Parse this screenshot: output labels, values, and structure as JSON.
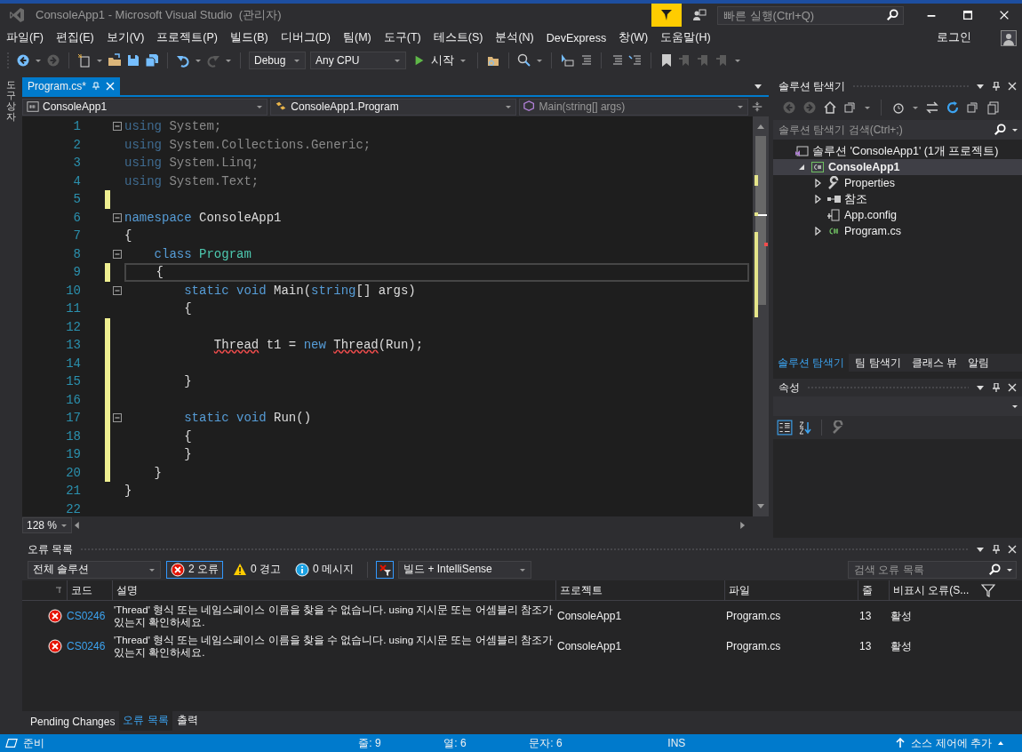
{
  "window": {
    "title": "ConsoleApp1 - Microsoft Visual Studio  (관리자)",
    "quick_launch_placeholder": "빠른 실행(Ctrl+Q)"
  },
  "menu": [
    {
      "label": "파일(F)"
    },
    {
      "label": "편집(E)"
    },
    {
      "label": "보기(V)"
    },
    {
      "label": "프로젝트(P)"
    },
    {
      "label": "빌드(B)"
    },
    {
      "label": "디버그(D)"
    },
    {
      "label": "팀(M)"
    },
    {
      "label": "도구(T)"
    },
    {
      "label": "테스트(S)"
    },
    {
      "label": "분석(N)"
    },
    {
      "label": "DevExpress"
    },
    {
      "label": "창(W)"
    },
    {
      "label": "도움말(H)"
    }
  ],
  "account": {
    "label": "로그인"
  },
  "toolbar": {
    "configuration": "Debug",
    "platform": "Any CPU",
    "start": "시작"
  },
  "toolbox": {
    "label": "도구 상자"
  },
  "editor": {
    "tab": {
      "label": "Program.cs*",
      "selected": true
    },
    "nav": [
      "ConsoleApp1",
      "ConsoleApp1.Program",
      "Main(string[] args)"
    ],
    "zoom": "128 %",
    "lines": [
      {
        "number": "1",
        "fold": true,
        "modified": false,
        "current": false,
        "tokens": [
          {
            "text": "using",
            "kind": "unused-keyword"
          },
          {
            "text": " System;",
            "kind": "unused"
          }
        ]
      },
      {
        "number": "2",
        "fold": false,
        "modified": false,
        "current": false,
        "tokens": [
          {
            "text": "using",
            "kind": "unused-keyword"
          },
          {
            "text": " System.Collections.Generic;",
            "kind": "unused"
          }
        ]
      },
      {
        "number": "3",
        "fold": false,
        "modified": false,
        "current": false,
        "tokens": [
          {
            "text": "using",
            "kind": "unused-keyword"
          },
          {
            "text": " System.Linq;",
            "kind": "unused"
          }
        ]
      },
      {
        "number": "4",
        "fold": false,
        "modified": false,
        "current": false,
        "tokens": [
          {
            "text": "using",
            "kind": "unused-keyword"
          },
          {
            "text": " System.Text;",
            "kind": "unused"
          }
        ]
      },
      {
        "number": "5",
        "fold": false,
        "modified": true,
        "current": false
      },
      {
        "number": "6",
        "fold": true,
        "modified": false,
        "current": false,
        "tokens": [
          {
            "text": "namespace",
            "kind": "keyword"
          },
          {
            "text": " ConsoleApp1",
            "kind": "plain"
          }
        ]
      },
      {
        "number": "7",
        "fold": false,
        "modified": false,
        "current": false,
        "tokens": [
          {
            "text": "{",
            "kind": "plain"
          }
        ]
      },
      {
        "number": "8",
        "fold": true,
        "modified": false,
        "current": false,
        "tokens": [
          {
            "text": "    class",
            "kind": "keyword"
          },
          {
            "text": " Program",
            "kind": "type"
          }
        ]
      },
      {
        "number": "9",
        "fold": false,
        "modified": true,
        "current": true,
        "tokens": [
          {
            "text": "    {",
            "kind": "plain"
          }
        ]
      },
      {
        "number": "10",
        "fold": true,
        "modified": false,
        "current": false,
        "tokens": [
          {
            "text": "        static void",
            "kind": "keyword"
          },
          {
            "text": " Main(",
            "kind": "plain"
          },
          {
            "text": "string",
            "kind": "keyword"
          },
          {
            "text": "[] args)",
            "kind": "plain"
          }
        ]
      },
      {
        "number": "11",
        "fold": false,
        "modified": false,
        "current": false,
        "tokens": [
          {
            "text": "        {",
            "kind": "plain"
          }
        ]
      },
      {
        "number": "12",
        "fold": false,
        "modified": true,
        "current": false
      },
      {
        "number": "13",
        "fold": false,
        "modified": true,
        "current": false,
        "tokens": [
          {
            "text": "            Thread",
            "kind": "error"
          },
          {
            "text": " t1 = ",
            "kind": "plain"
          },
          {
            "text": "new",
            "kind": "keyword"
          },
          {
            "text": " Thread",
            "kind": "error"
          },
          {
            "text": "(Run);",
            "kind": "plain"
          }
        ]
      },
      {
        "number": "14",
        "fold": false,
        "modified": true,
        "current": false
      },
      {
        "number": "15",
        "fold": false,
        "modified": true,
        "current": false,
        "tokens": [
          {
            "text": "        }",
            "kind": "plain"
          }
        ]
      },
      {
        "number": "16",
        "fold": false,
        "modified": true,
        "current": false
      },
      {
        "number": "17",
        "fold": true,
        "modified": true,
        "current": false,
        "tokens": [
          {
            "text": "        static void",
            "kind": "keyword"
          },
          {
            "text": " Run()",
            "kind": "plain"
          }
        ]
      },
      {
        "number": "18",
        "fold": false,
        "modified": true,
        "current": false,
        "tokens": [
          {
            "text": "        {",
            "kind": "plain"
          }
        ]
      },
      {
        "number": "19",
        "fold": false,
        "modified": true,
        "current": false,
        "tokens": [
          {
            "text": "        }",
            "kind": "plain"
          }
        ]
      },
      {
        "number": "20",
        "fold": false,
        "modified": true,
        "current": false,
        "tokens": [
          {
            "text": "    }",
            "kind": "plain"
          }
        ]
      },
      {
        "number": "21",
        "fold": false,
        "modified": false,
        "current": false,
        "tokens": [
          {
            "text": "}",
            "kind": "plain"
          }
        ]
      },
      {
        "number": "22",
        "fold": false,
        "modified": false,
        "current": false
      }
    ]
  },
  "solution_explorer": {
    "title": "솔루션 탐색기",
    "search_placeholder": "솔루션 탐색기 검색(Ctrl+;)",
    "tree": [
      {
        "label": "솔루션 'ConsoleApp1' (1개 프로젝트)",
        "kind": "solution",
        "selected": false,
        "children": [
          {
            "label": "ConsoleApp1",
            "kind": "project",
            "selected": true,
            "expanded": true,
            "children": [
              {
                "label": "Properties",
                "kind": "properties",
                "selected": false,
                "expanded": false
              },
              {
                "label": "참조",
                "kind": "references",
                "selected": false,
                "expanded": false
              },
              {
                "label": "App.config",
                "kind": "config",
                "selected": false
              },
              {
                "label": "Program.cs",
                "kind": "csharp",
                "selected": false,
                "expanded": false
              }
            ]
          }
        ]
      }
    ],
    "tabs": [
      {
        "label": "솔루션 탐색기",
        "selected": true
      },
      {
        "label": "팀 탐색기",
        "selected": false
      },
      {
        "label": "클래스 뷰",
        "selected": false
      },
      {
        "label": "알림",
        "selected": false
      }
    ]
  },
  "properties": {
    "title": "속성"
  },
  "error_list": {
    "title": "오류 목록",
    "scope": "전체 솔루션",
    "filters": [
      {
        "kind": "error",
        "label": "2 오류",
        "selected": true
      },
      {
        "kind": "warning",
        "label": "0 경고",
        "selected": false
      },
      {
        "kind": "message",
        "label": "0 메시지",
        "selected": false
      }
    ],
    "source": "빌드 + IntelliSense",
    "search_placeholder": "검색 오류 목록",
    "columns": [
      "코드",
      "설명",
      "프로젝트",
      "파일",
      "줄",
      "비표시 오류(S..."
    ],
    "rows": [
      {
        "kind": "error",
        "code": "CS0246",
        "description": "'Thread' 형식 또는 네임스페이스 이름을 찾을 수 없습니다. using 지시문 또는 어셈블리 참조가 있는지 확인하세요.",
        "project": "ConsoleApp1",
        "file": "Program.cs",
        "line": "13",
        "status": "활성"
      },
      {
        "kind": "error",
        "code": "CS0246",
        "description": "'Thread' 형식 또는 네임스페이스 이름을 찾을 수 없습니다. using 지시문 또는 어셈블리 참조가 있는지 확인하세요.",
        "project": "ConsoleApp1",
        "file": "Program.cs",
        "line": "13",
        "status": "활성"
      }
    ]
  },
  "bottom_tabs": [
    {
      "label": "Pending Changes",
      "selected": false
    },
    {
      "label": "오류 목록",
      "selected": true
    },
    {
      "label": "출력",
      "selected": false
    }
  ],
  "status_bar": {
    "state": "준비",
    "line": "줄: 9",
    "column": "열: 6",
    "char": "문자: 6",
    "mode": "INS",
    "source_control": "소스 제어에 추가"
  }
}
